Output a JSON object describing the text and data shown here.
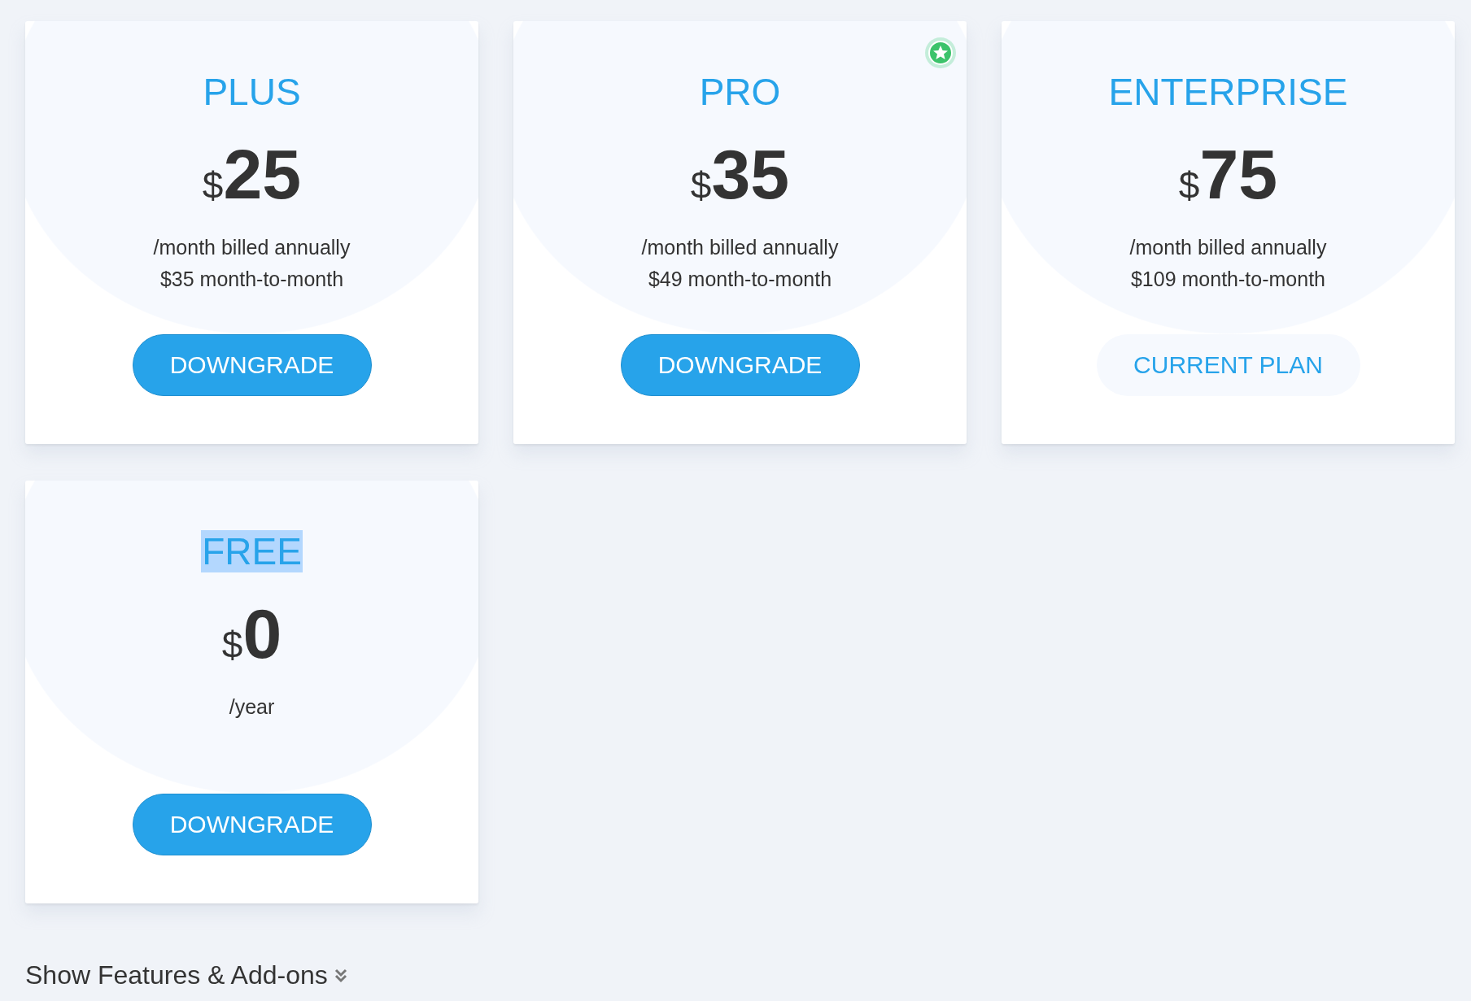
{
  "plans": [
    {
      "name": "PLUS",
      "highlighted": false,
      "recommended": false,
      "currency": "$",
      "price": "25",
      "lines": [
        "/month billed annually",
        "$35 month-to-month"
      ],
      "button": {
        "label": "DOWNGRADE",
        "current": false
      }
    },
    {
      "name": "PRO",
      "highlighted": false,
      "recommended": true,
      "currency": "$",
      "price": "35",
      "lines": [
        "/month billed annually",
        "$49 month-to-month"
      ],
      "button": {
        "label": "DOWNGRADE",
        "current": false
      }
    },
    {
      "name": "ENTERPRISE",
      "highlighted": false,
      "recommended": false,
      "currency": "$",
      "price": "75",
      "lines": [
        "/month billed annually",
        "$109 month-to-month"
      ],
      "button": {
        "label": "CURRENT PLAN",
        "current": true
      }
    },
    {
      "name": "FREE",
      "highlighted": true,
      "recommended": false,
      "currency": "$",
      "price": "0",
      "lines": [
        "/year"
      ],
      "button": {
        "label": "DOWNGRADE",
        "current": false
      }
    }
  ],
  "toggle": {
    "label": "Show Features & Add-ons"
  }
}
